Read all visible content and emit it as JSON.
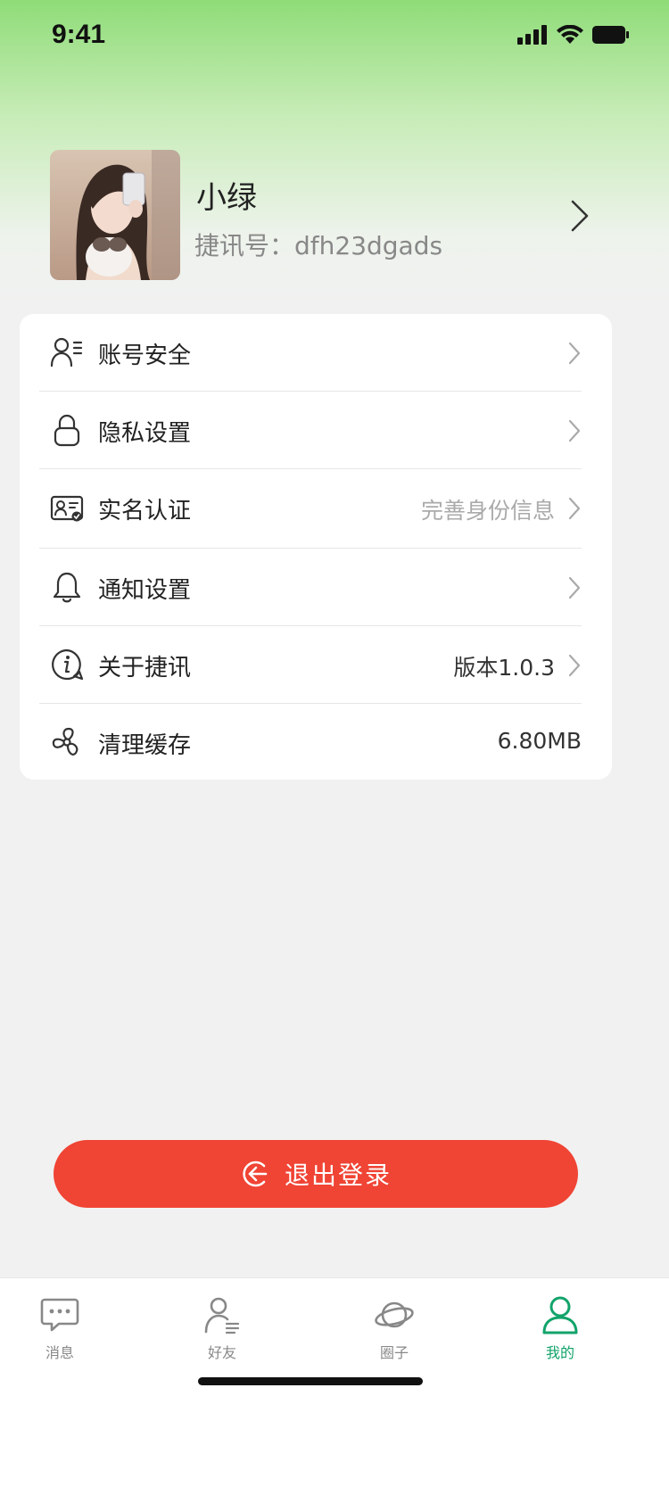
{
  "status_bar": {
    "time": "9:41"
  },
  "profile": {
    "nickname": "小绿",
    "jx_id": "捷讯号：dfh23dgads"
  },
  "menu": [
    {
      "label": "账号安全",
      "value": "",
      "icon": "user-list-icon",
      "chevron": true
    },
    {
      "label": "隐私设置",
      "value": "",
      "icon": "lock-icon",
      "chevron": true
    },
    {
      "label": "实名认证",
      "value": "完善身份信息",
      "icon": "id-card-icon",
      "chevron": true,
      "muted": true
    },
    {
      "label": "通知设置",
      "value": "",
      "icon": "bell-icon",
      "chevron": true
    },
    {
      "label": "关于捷讯",
      "value": "版本1.0.3",
      "icon": "info-bubble-icon",
      "chevron": true
    },
    {
      "label": "清理缓存",
      "value": "6.80MB",
      "icon": "fan-icon",
      "chevron": false
    }
  ],
  "logout": {
    "label": "退出登录"
  },
  "tabs": [
    {
      "label": "消息",
      "icon": "chat-icon",
      "active": false
    },
    {
      "label": "好友",
      "icon": "friends-icon",
      "active": false
    },
    {
      "label": "圈子",
      "icon": "planet-icon",
      "active": false
    },
    {
      "label": "我的",
      "icon": "profile-icon",
      "active": true
    }
  ],
  "colors": {
    "accent": "#12a36a",
    "logout": "#f04434",
    "header_green": "#8fdc78"
  }
}
